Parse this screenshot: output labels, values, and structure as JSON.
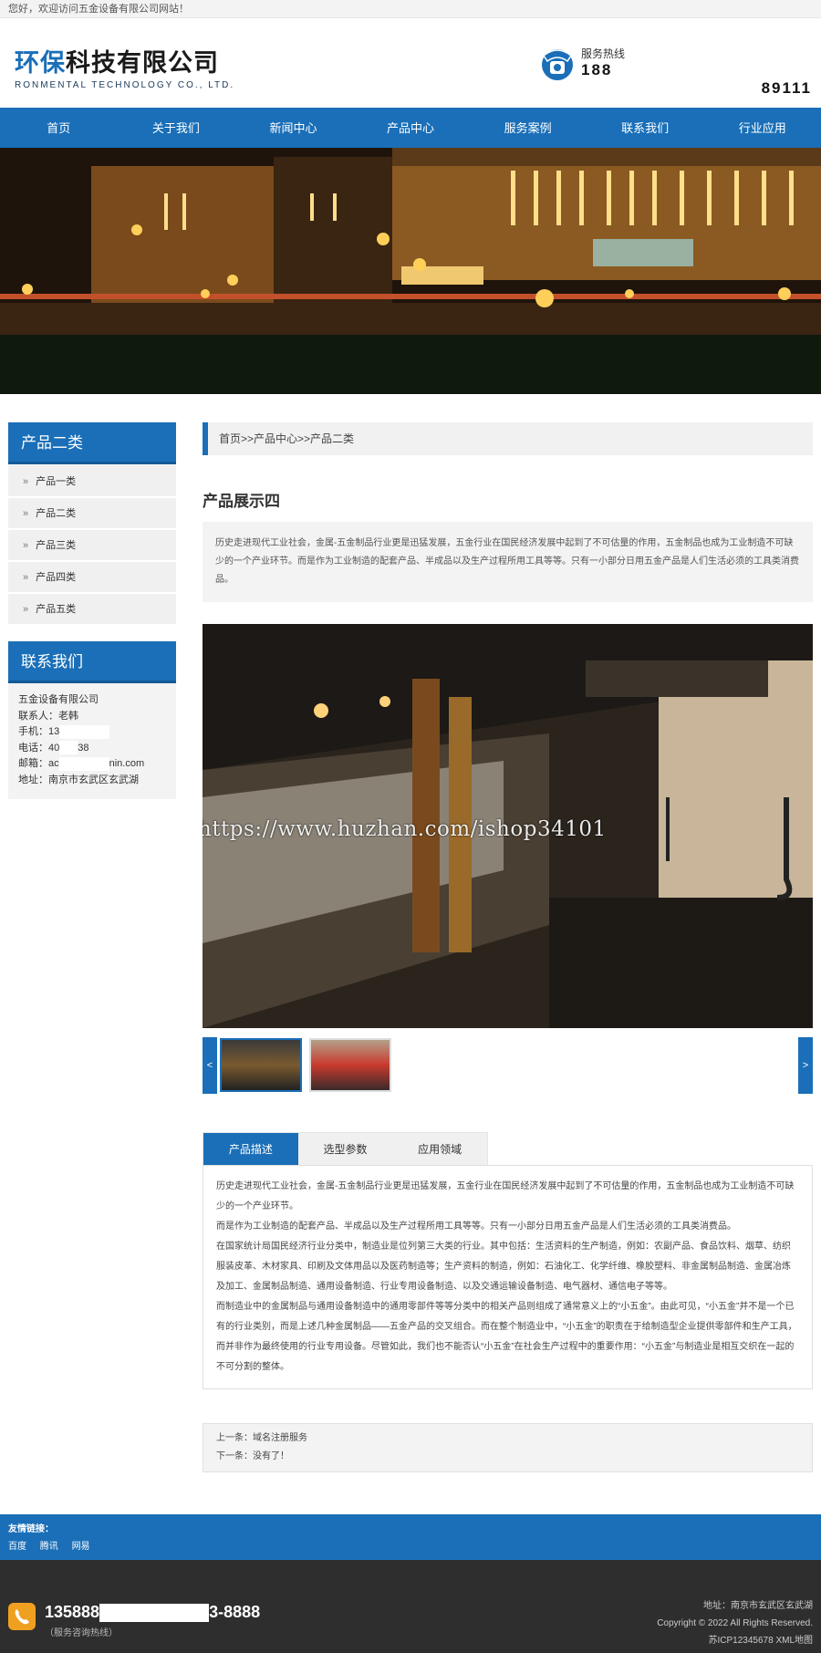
{
  "topbar": {
    "welcome": "您好，欢迎访问五金设备有限公司网站！"
  },
  "header": {
    "logo_cn_blue": "环保",
    "logo_cn_dark": "科技有限公司",
    "logo_en": "RONMENTAL TECHNOLOGY CO., LTD.",
    "hotline_label": "服务热线",
    "hotline_num1": "188",
    "hotline_num2": "89111"
  },
  "nav": {
    "items": [
      "首页",
      "关于我们",
      "新闻中心",
      "产品中心",
      "服务案例",
      "联系我们",
      "行业应用"
    ]
  },
  "sidebar": {
    "category_title": "产品二类",
    "categories": [
      "产品一类",
      "产品二类",
      "产品三类",
      "产品四类",
      "产品五类"
    ],
    "contact_title": "联系我们",
    "contact": {
      "company": "五金设备有限公司",
      "person": "联系人：老韩",
      "mobile": "手机：13",
      "phone_a": "电话：40",
      "phone_b": "38",
      "email_a": "邮箱：ac",
      "email_b": "nin.com",
      "address": "地址：南京市玄武区玄武湖"
    }
  },
  "main": {
    "breadcrumb": "首页>>产品中心>>产品二类",
    "product_title": "产品展示四",
    "intro": "历史走进现代工业社会，金属-五金制品行业更是迅猛发展，五金行业在国民经济发展中起到了不可估量的作用，五金制品也成为工业制造不可缺少的一个产业环节。而是作为工业制造的配套产品、半成品以及生产过程所用工具等等。只有一小部分日用五金产品是人们生活必须的工具类消费品。",
    "watermark": "https://www.huzhan.com/ishop34101",
    "arrow_left": "<",
    "arrow_right": ">",
    "tabs": [
      "产品描述",
      "选型参数",
      "应用领域"
    ],
    "description": [
      "历史走进现代工业社会，金属-五金制品行业更是迅猛发展，五金行业在国民经济发展中起到了不可估量的作用，五金制品也成为工业制造不可缺少的一个产业环节。",
      "而是作为工业制造的配套产品、半成品以及生产过程所用工具等等。只有一小部分日用五金产品是人们生活必须的工具类消费品。",
      "在国家统计局国民经济行业分类中，制造业是位列第三大类的行业。其中包括：生活资料的生产制造，例如：农副产品、食品饮料、烟草、纺织服装皮革、木材家具、印刷及文体用品以及医药制造等；生产资料的制造，例如：石油化工、化学纤维、橡胶塑料、非金属制品制造、金属冶炼及加工、金属制品制造、通用设备制造、行业专用设备制造、以及交通运输设备制造、电气器材、通信电子等等。",
      "而制造业中的金属制品与通用设备制造中的通用零部件等等分类中的相关产品则组成了通常意义上的“小五金”。由此可见，“小五金”并不是一个已有的行业类别，而是上述几种金属制品——五金产品的交叉组合。而在整个制造业中，“小五金”的职责在于给制造型企业提供零部件和生产工具，而并非作为最终使用的行业专用设备。尽管如此，我们也不能否认“小五金”在社会生产过程中的重要作用：“小五金”与制造业是相互交织在一起的不可分割的整体。"
    ],
    "prev": "上一条：域名注册服务",
    "next": "下一条：没有了！"
  },
  "friends": {
    "title": "友情链接：",
    "links": [
      "百度",
      "腾讯",
      "网易"
    ]
  },
  "footer": {
    "phone_a": "135888",
    "phone_b": "3-8888",
    "phone_sub": "（服务咨询热线）",
    "address": "地址：南京市玄武区玄武湖",
    "copyright": "Copyright © 2022 All Rights Reserved.",
    "icp": "苏ICP12345678",
    "xml": "XML地图"
  },
  "colors": {
    "brand_blue": "#1a6fb8",
    "footer_bg": "#2e2e2e"
  }
}
